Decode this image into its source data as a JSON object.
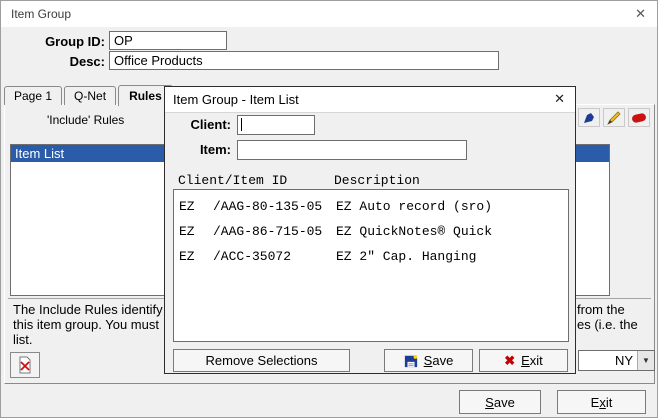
{
  "window": {
    "title": "Item Group",
    "close_glyph": "✕"
  },
  "form": {
    "group_id_label": "Group ID:",
    "group_id_value": "OP",
    "desc_label": "Desc:",
    "desc_value": "Office Products"
  },
  "tabs": [
    {
      "label": "Page 1"
    },
    {
      "label": "Q-Net"
    },
    {
      "label": "Rules"
    }
  ],
  "rules_tab": {
    "include_rules_label": "'Include' Rules",
    "selected_rule": "Item List",
    "help_left_lines": [
      "The Include Rules identify v",
      "this item group.  You must",
      "list."
    ],
    "help_right_lines": [
      "from the",
      "es (i.e. the"
    ],
    "region_combo_value": "NY",
    "dropdown_arrow": "▼"
  },
  "modal": {
    "title": "Item Group - Item List",
    "close_glyph": "✕",
    "client_label": "Client:",
    "client_value": "",
    "item_label": "Item:",
    "item_value": "",
    "columns": {
      "client_item": "Client/Item ID",
      "description": "Description"
    },
    "rows": [
      {
        "client": "EZ",
        "item_id": "/AAG-80-135-05",
        "description": "EZ Auto record (sro)"
      },
      {
        "client": "EZ",
        "item_id": "/AAG-86-715-05",
        "description": "EZ QuickNotes® Quick"
      },
      {
        "client": "EZ",
        "item_id": "/ACC-35072",
        "description": "EZ 2\" Cap. Hanging"
      }
    ],
    "buttons": {
      "remove": "Remove Selections",
      "save_accel": "S",
      "save_rest": "ave",
      "exit_accel": "E",
      "exit_rest": "xit",
      "exit_icon": "✖"
    }
  },
  "footer": {
    "save_accel": "S",
    "save_rest": "ave",
    "exit_pre": "E",
    "exit_accel": "x",
    "exit_rest": "it"
  }
}
